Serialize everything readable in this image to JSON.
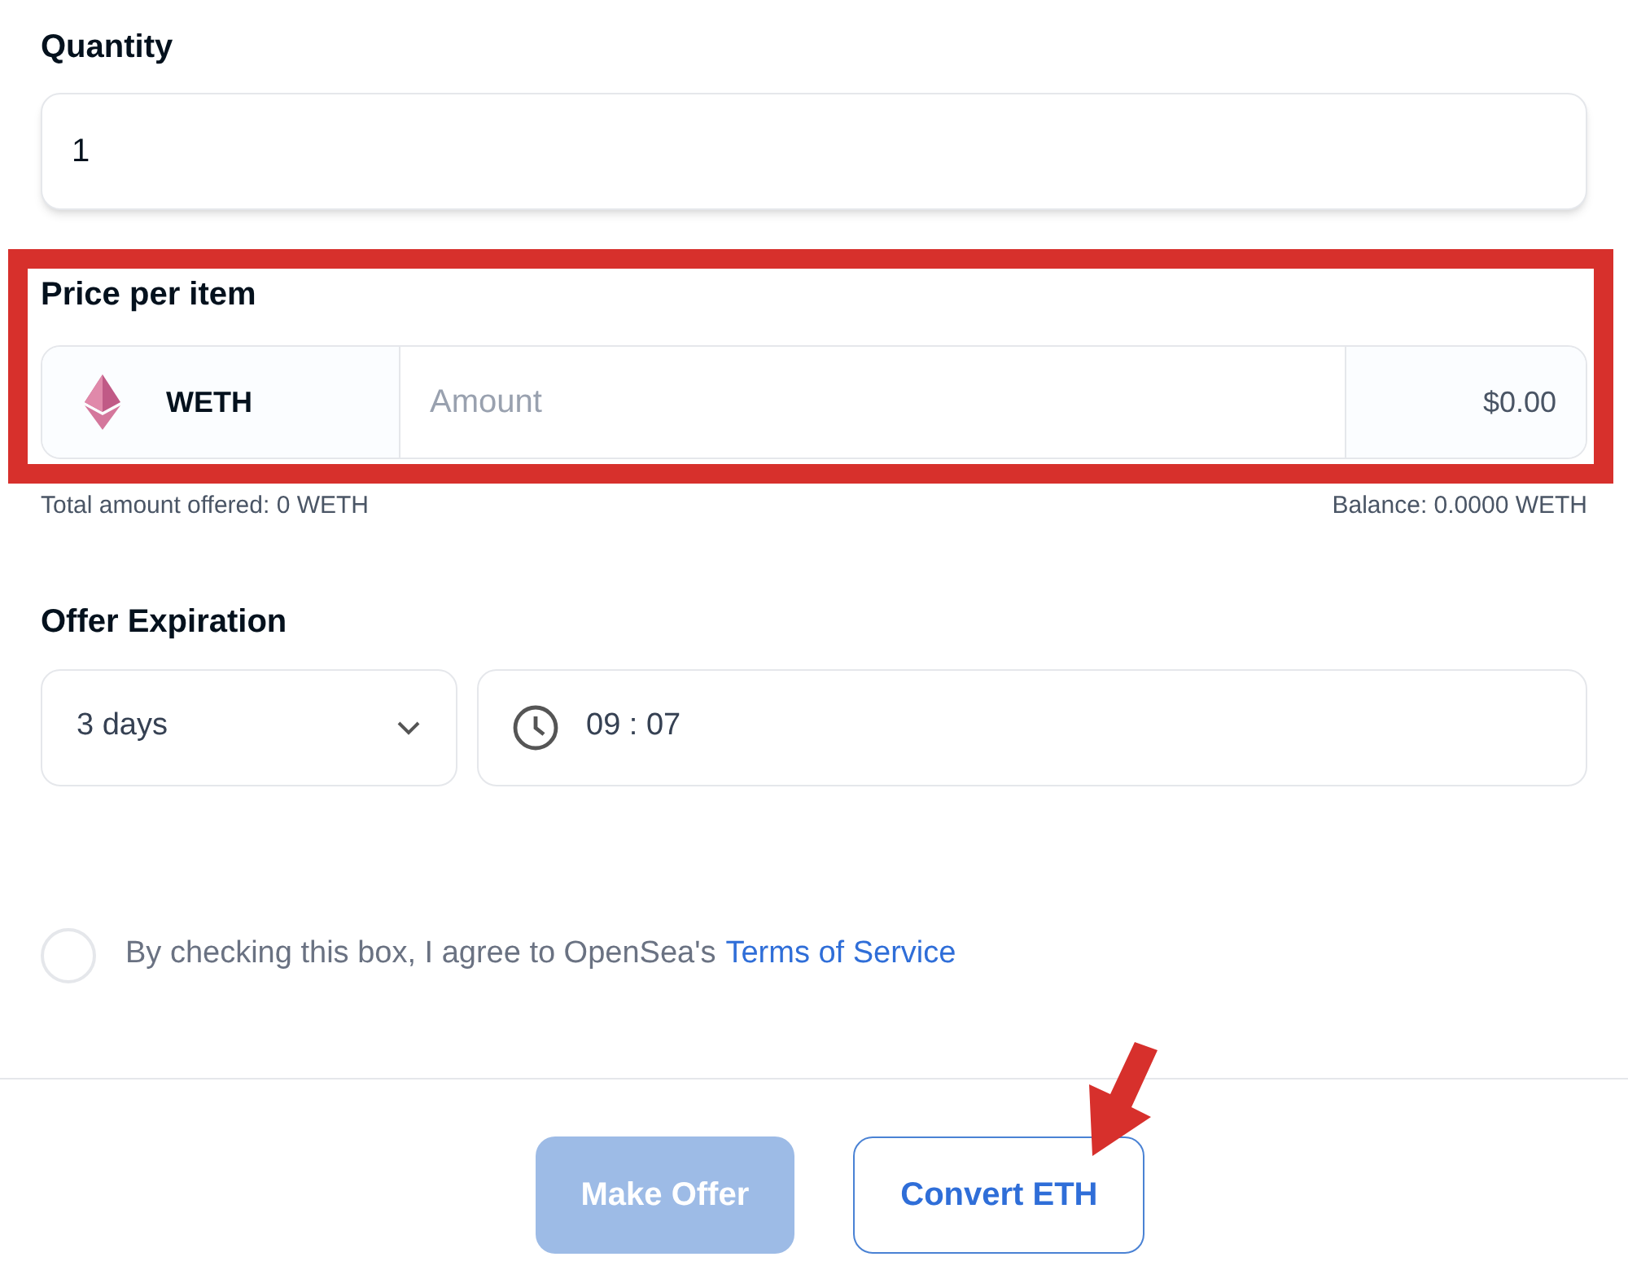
{
  "quantity": {
    "label": "Quantity",
    "value": "1"
  },
  "price": {
    "label": "Price per item",
    "currency": "WETH",
    "placeholder": "Amount",
    "usd": "$0.00",
    "total": "Total amount offered: 0 WETH",
    "balance": "Balance: 0.0000 WETH",
    "highlighted": true
  },
  "expiration": {
    "label": "Offer Expiration",
    "duration": "3 days",
    "time": "09 : 07"
  },
  "agreement": {
    "checked": false,
    "text": "By checking this box, I agree to OpenSea's",
    "link": "Terms of Service"
  },
  "buttons": [
    {
      "label": "Make Offer",
      "kind": "primary",
      "disabled": true
    },
    {
      "label": "Convert ETH",
      "kind": "secondary",
      "disabled": false,
      "pointed": true
    }
  ]
}
